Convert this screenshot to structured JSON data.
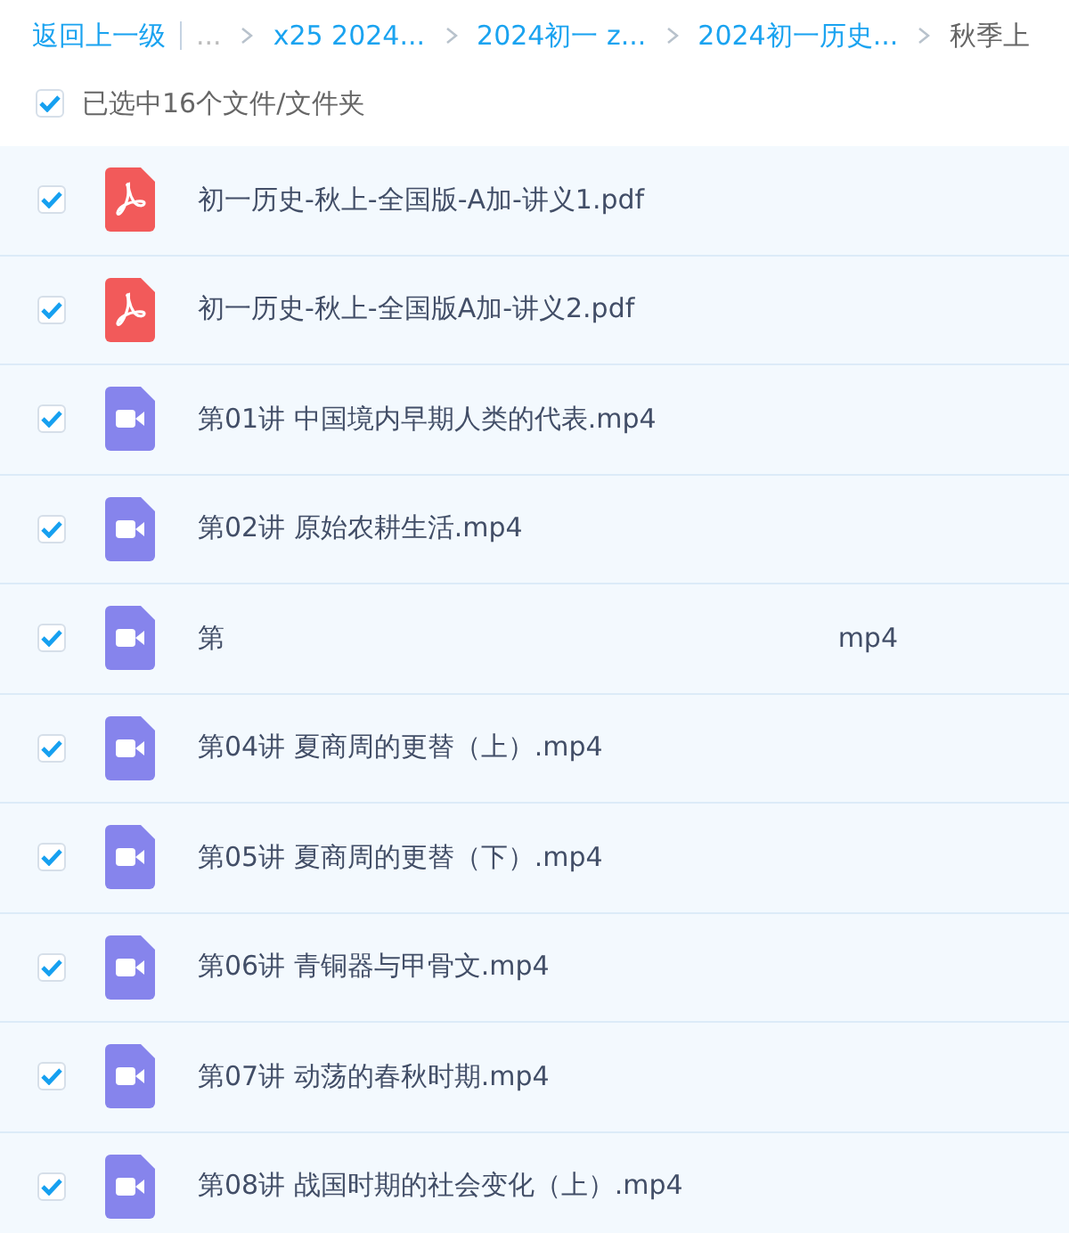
{
  "breadcrumb": {
    "back": "返回上一级",
    "ellipsis": "...",
    "items": [
      {
        "label": "x25 2024...",
        "current": false
      },
      {
        "label": "2024初一 z...",
        "current": false
      },
      {
        "label": "2024初一历史...",
        "current": false
      },
      {
        "label": "秋季上",
        "current": true
      }
    ]
  },
  "select_all": {
    "checked": true,
    "label": "已选中16个文件/文件夹"
  },
  "files": [
    {
      "kind": "pdf",
      "name": "初一历史-秋上-全国版-A加-讲义1.pdf",
      "checked": true
    },
    {
      "kind": "pdf",
      "name": "初一历史-秋上-全国版A加-讲义2.pdf",
      "checked": true
    },
    {
      "kind": "video",
      "name": "第01讲 中国境内早期人类的代表.mp4",
      "checked": true
    },
    {
      "kind": "video",
      "name": "第02讲 原始农耕生活.mp4",
      "checked": true
    },
    {
      "kind": "video",
      "name": "第",
      "name_tail": "mp4",
      "checked": true
    },
    {
      "kind": "video",
      "name": "第04讲 夏商周的更替（上）.mp4",
      "checked": true
    },
    {
      "kind": "video",
      "name": "第05讲 夏商周的更替（下）.mp4",
      "checked": true
    },
    {
      "kind": "video",
      "name": "第06讲 青铜器与甲骨文.mp4",
      "checked": true
    },
    {
      "kind": "video",
      "name": "第07讲 动荡的春秋时期.mp4",
      "checked": true
    },
    {
      "kind": "video",
      "name": "第08讲 战国时期的社会变化（上）.mp4",
      "checked": true
    }
  ]
}
